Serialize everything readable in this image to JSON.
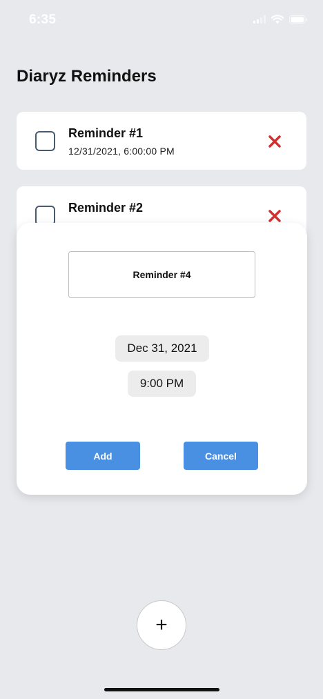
{
  "status_bar": {
    "time": "6:35"
  },
  "header": {
    "title": "Diaryz Reminders"
  },
  "reminders": [
    {
      "title": "Reminder #1",
      "datetime": "12/31/2021, 6:00:00 PM"
    },
    {
      "title": "Reminder #2"
    }
  ],
  "modal": {
    "name_value": "Reminder #4",
    "date": "Dec 31, 2021",
    "time": "9:00 PM",
    "add_label": "Add",
    "cancel_label": "Cancel"
  },
  "fab": {
    "label": "+"
  },
  "colors": {
    "background": "#e8e9ed",
    "accent": "#4a90e2",
    "delete": "#d32f2f"
  },
  "icons": {
    "status": [
      "signal-icon",
      "wifi-icon",
      "battery-icon"
    ],
    "reminder": [
      "checkbox-icon",
      "delete-icon"
    ]
  }
}
